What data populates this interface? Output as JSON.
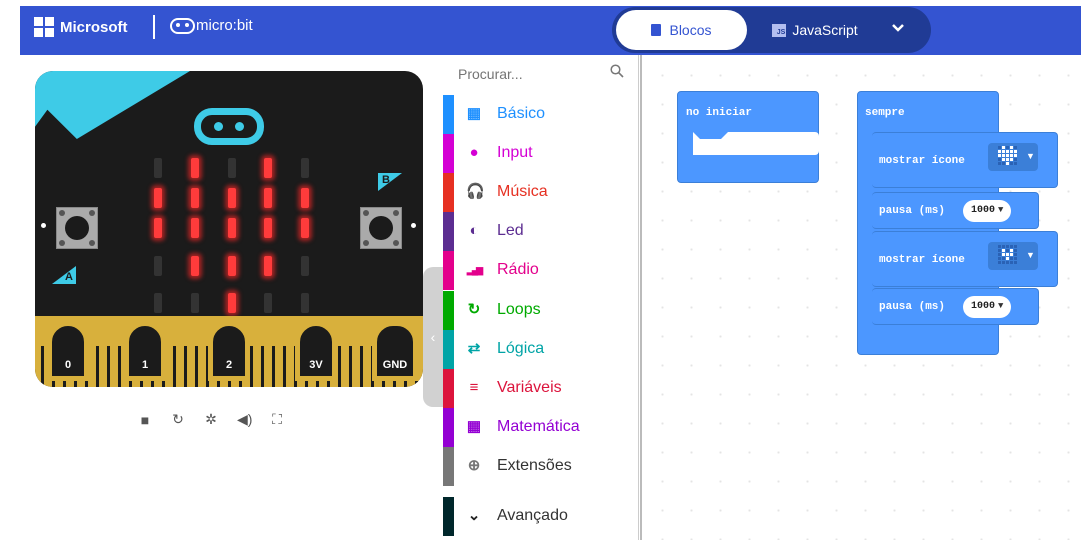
{
  "header": {
    "brand": "Microsoft",
    "product": "micro:bit",
    "tabs": {
      "blocks": "Blocos",
      "javascript": "JavaScript",
      "js_badge": "JS"
    }
  },
  "simulator": {
    "button_a": "A",
    "button_b": "B",
    "pins": [
      "0",
      "1",
      "2",
      "3V",
      "GND"
    ],
    "leds": [
      [
        0,
        1,
        0,
        1,
        0
      ],
      [
        1,
        1,
        1,
        1,
        1
      ],
      [
        1,
        1,
        1,
        1,
        1
      ],
      [
        0,
        1,
        1,
        1,
        0
      ],
      [
        0,
        0,
        1,
        0,
        0
      ]
    ],
    "controls": [
      "stop-icon",
      "restart-icon",
      "debug-icon",
      "mute-icon",
      "fullscreen-icon"
    ]
  },
  "toolbox": {
    "search_placeholder": "Procurar...",
    "categories": [
      {
        "label": "Básico",
        "color": "#1e90ff",
        "icon": "grid-icon"
      },
      {
        "label": "Input",
        "color": "#d400d4",
        "icon": "circle-icon"
      },
      {
        "label": "Música",
        "color": "#e63022",
        "icon": "headphones-icon"
      },
      {
        "label": "Led",
        "color": "#5c2d91",
        "icon": "toggle-icon"
      },
      {
        "label": "Rádio",
        "color": "#e3008c",
        "icon": "signal-icon"
      },
      {
        "label": "Loops",
        "color": "#00aa00",
        "icon": "loop-icon"
      },
      {
        "label": "Lógica",
        "color": "#00a4a6",
        "icon": "shuffle-icon"
      },
      {
        "label": "Variáveis",
        "color": "#dc143c",
        "icon": "list-icon"
      },
      {
        "label": "Matemática",
        "color": "#9400d3",
        "icon": "calculator-icon"
      },
      {
        "label": "Extensões",
        "color": "#777777",
        "icon": "plus-circle-icon"
      },
      {
        "label": "Avançado",
        "color": "#00272b",
        "icon": "chevron-down-icon"
      }
    ]
  },
  "workspace": {
    "on_start": {
      "label": "no iniciar"
    },
    "forever": {
      "label": "sempre",
      "statements": [
        {
          "label": "mostrar ícone",
          "icon": "big-heart"
        },
        {
          "label": "pausa (ms)",
          "value": "1000"
        },
        {
          "label": "mostrar ícone",
          "icon": "small-heart"
        },
        {
          "label": "pausa (ms)",
          "value": "1000"
        }
      ]
    }
  },
  "colors": {
    "header": "#3454d1",
    "toggle": "#203b95",
    "block": "#4c97ff",
    "board": "#1b1b1b",
    "accent": "#3ecbe7",
    "edge": "#d8b03c",
    "led_on": "#ff3b3b"
  }
}
